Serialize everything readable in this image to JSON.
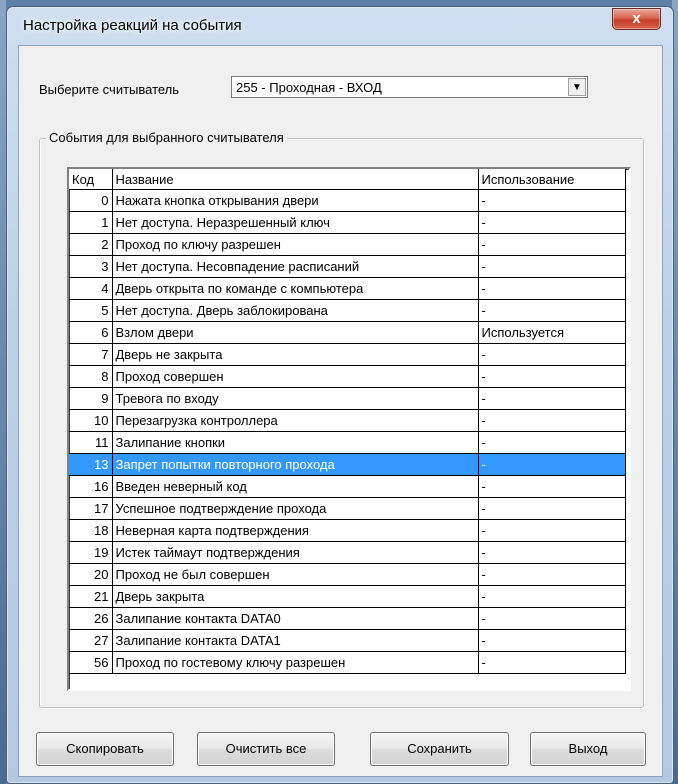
{
  "window": {
    "title": "Настройка реакций на события",
    "close_symbol": "x"
  },
  "reader": {
    "label": "Выберите считыватель",
    "selected": "255 - Проходная - ВХОД",
    "dropdown_arrow": "▼"
  },
  "group": {
    "title": "События для выбранного считывателя"
  },
  "table": {
    "headers": [
      "Код",
      "Название",
      "Использование"
    ],
    "selected_index": 12,
    "rows": [
      {
        "code": "0",
        "name": "Нажата кнопка открывания двери",
        "usage": "-"
      },
      {
        "code": "1",
        "name": "Нет доступа. Неразрешенный ключ",
        "usage": "-"
      },
      {
        "code": "2",
        "name": "Проход по ключу разрешен",
        "usage": "-"
      },
      {
        "code": "3",
        "name": "Нет доступа. Несовпадение расписаний",
        "usage": "-"
      },
      {
        "code": "4",
        "name": "Дверь открыта по команде с компьютера",
        "usage": "-"
      },
      {
        "code": "5",
        "name": "Нет доступа. Дверь заблокирована",
        "usage": "-"
      },
      {
        "code": "6",
        "name": "Взлом двери",
        "usage": "Используется"
      },
      {
        "code": "7",
        "name": "Дверь не закрыта",
        "usage": "-"
      },
      {
        "code": "8",
        "name": "Проход совершен",
        "usage": "-"
      },
      {
        "code": "9",
        "name": "Тревога по входу",
        "usage": "-"
      },
      {
        "code": "10",
        "name": "Перезагрузка контроллера",
        "usage": "-"
      },
      {
        "code": "11",
        "name": "Залипание кнопки",
        "usage": "-"
      },
      {
        "code": "13",
        "name": "Запрет попытки повторного прохода",
        "usage": "-"
      },
      {
        "code": "16",
        "name": "Введен неверный код",
        "usage": "-"
      },
      {
        "code": "17",
        "name": "Успешное подтверждение прохода",
        "usage": "-"
      },
      {
        "code": "18",
        "name": "Неверная карта подтверждения",
        "usage": "-"
      },
      {
        "code": "19",
        "name": "Истек таймаут подтверждения",
        "usage": "-"
      },
      {
        "code": "20",
        "name": "Проход не был совершен",
        "usage": "-"
      },
      {
        "code": "21",
        "name": "Дверь закрыта",
        "usage": "-"
      },
      {
        "code": "26",
        "name": "Залипание контакта DATA0",
        "usage": "-"
      },
      {
        "code": "27",
        "name": "Залипание контакта DATA1",
        "usage": "-"
      },
      {
        "code": "56",
        "name": "Проход по гостевому ключу разрешен",
        "usage": "-"
      }
    ]
  },
  "buttons": {
    "copy": "Скопировать",
    "clear_all": "Очистить все",
    "save": "Сохранить",
    "exit": "Выход"
  },
  "colors": {
    "selection": "#3399ff",
    "close_button": "#c43d24"
  }
}
